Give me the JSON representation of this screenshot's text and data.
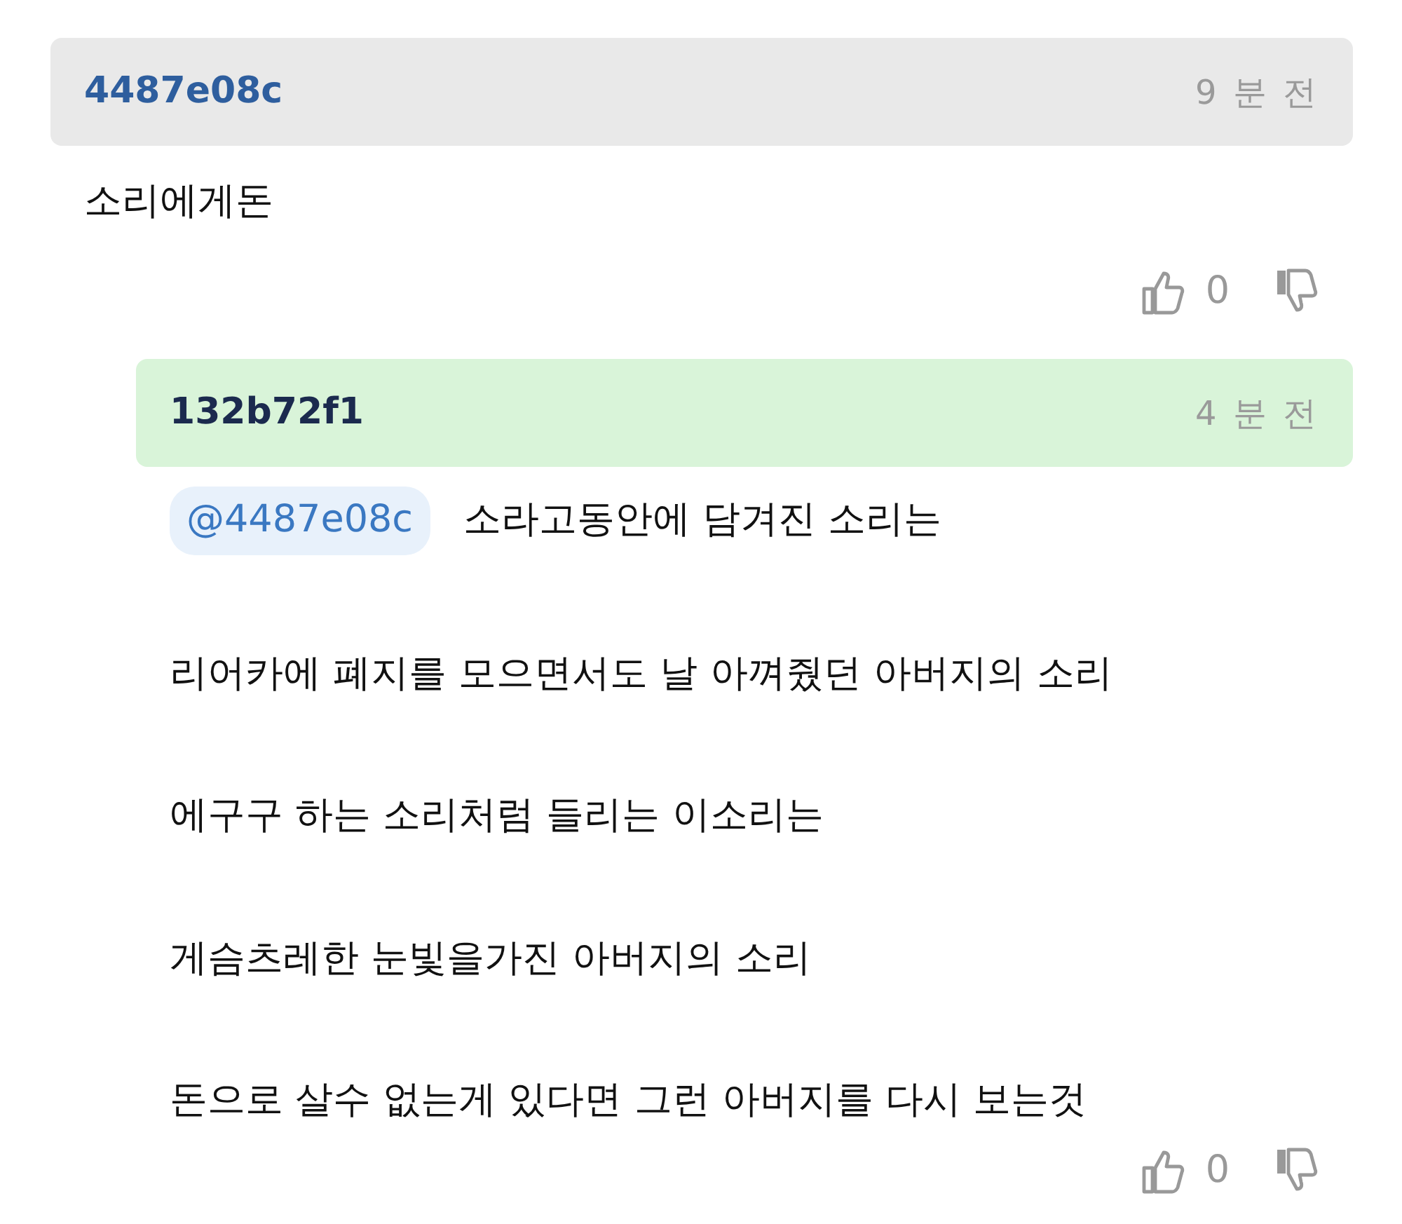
{
  "comments": [
    {
      "kind": "top",
      "author": "4487e08c",
      "time": "9 분 전",
      "paragraphs": [
        "소리에게돈"
      ],
      "likes": "0"
    },
    {
      "kind": "reply",
      "author": "132b72f1",
      "time": "4 분 전",
      "mention": "@4487e08c",
      "paragraphs": [
        "소라고동안에 담겨진 소리는",
        "리어카에 폐지를 모으면서도 날 아껴줬던 아버지의 소리",
        "에구구 하는 소리처럼 들리는 이소리는",
        "게슴츠레한 눈빛을가진 아버지의 소리",
        "돈으로 살수 없는게 있다면 그런 아버지를 다시 보는것"
      ],
      "likes": "0"
    }
  ]
}
